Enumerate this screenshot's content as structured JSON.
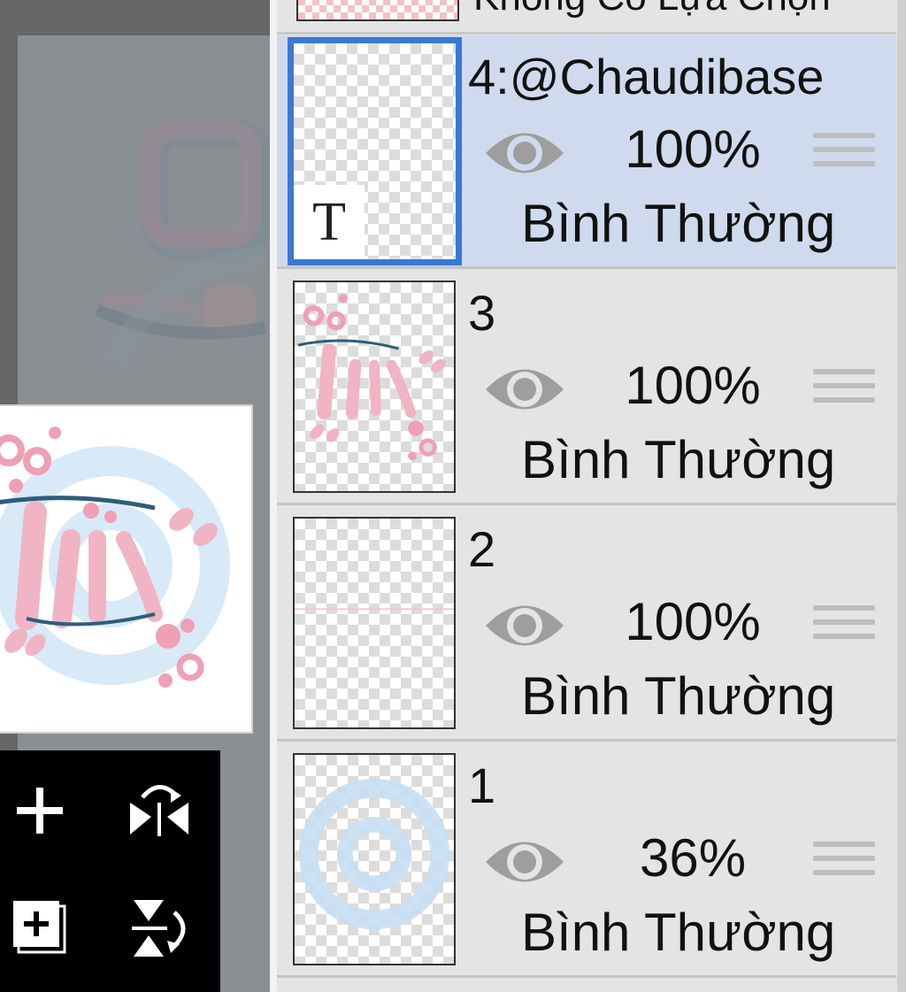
{
  "top_layer": {
    "label": "Không Có Lựa Chọn"
  },
  "layers": [
    {
      "name": "4:@Chaudibase",
      "opacity": "100%",
      "blend": "Bình Thường",
      "selected": true,
      "badge": "T"
    },
    {
      "name": "3",
      "opacity": "100%",
      "blend": "Bình Thường",
      "selected": false
    },
    {
      "name": "2",
      "opacity": "100%",
      "blend": "Bình Thường",
      "selected": false
    },
    {
      "name": "1",
      "opacity": "36%",
      "blend": "Bình Thường",
      "selected": false
    }
  ],
  "colors": {
    "selection": "#3a78d4",
    "selected_row": "#cfdaee",
    "panel_bg": "#e4e4e4",
    "art_pink": "#f2b8c6",
    "art_blue": "#bcd8ee"
  },
  "tools": [
    "add-icon",
    "flip-horizontal-icon",
    "add-layer-icon",
    "flip-vertical-icon"
  ]
}
